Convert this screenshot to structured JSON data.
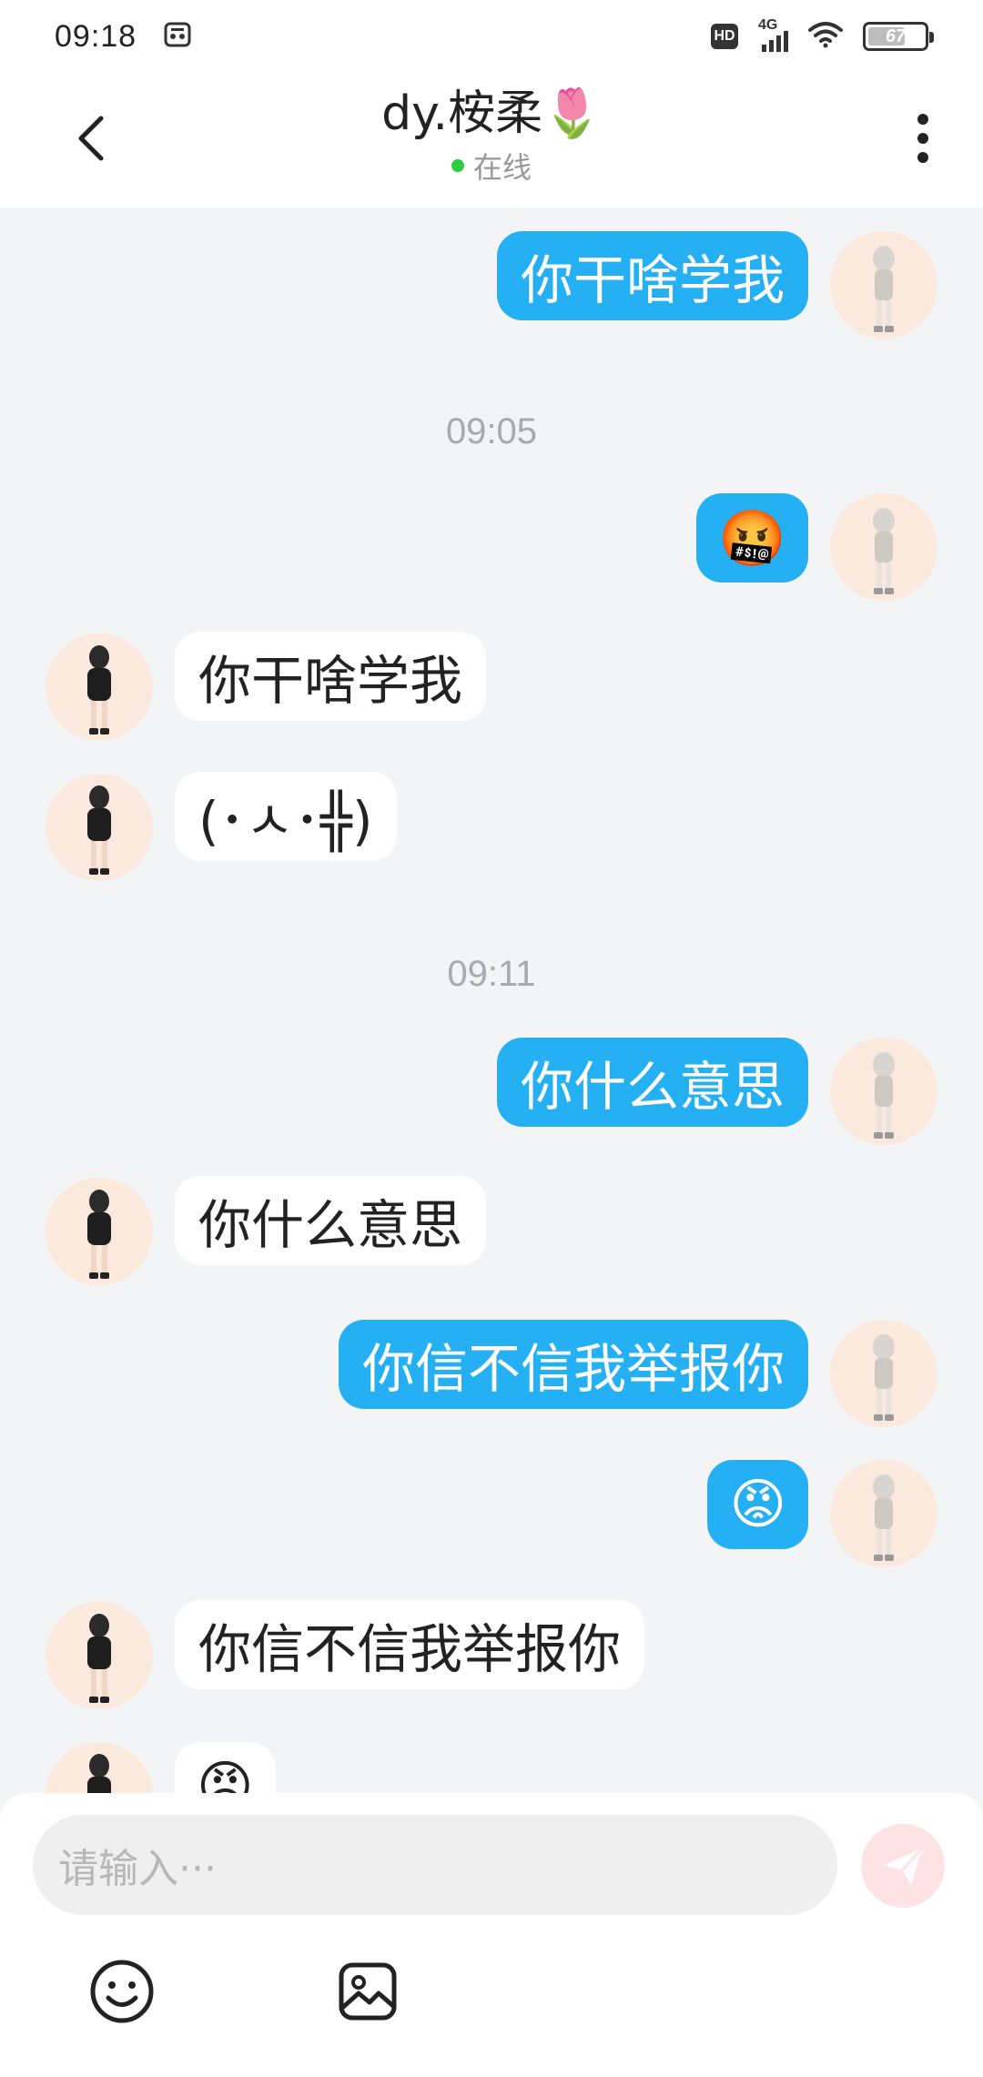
{
  "status_bar": {
    "time": "09:18",
    "network": "4G",
    "battery_text": "67",
    "battery_level_percent": 67
  },
  "header": {
    "contact_name": "dy.桉柔🌷",
    "status": "在线"
  },
  "messages": [
    {
      "side": "out",
      "text": "你干啥学我"
    },
    {
      "side": "time",
      "text": "09:05"
    },
    {
      "side": "out",
      "text": "🤬"
    },
    {
      "side": "in",
      "text": "你干啥学我"
    },
    {
      "side": "in",
      "text": "(･ㅅ･╬)"
    },
    {
      "side": "time",
      "text": "09:11"
    },
    {
      "side": "out",
      "text": "你什么意思"
    },
    {
      "side": "in",
      "text": "你什么意思"
    },
    {
      "side": "out",
      "text": "你信不信我举报你"
    },
    {
      "side": "out",
      "text": "😡"
    },
    {
      "side": "in",
      "text": "你信不信我举报你"
    },
    {
      "side": "in",
      "text": "😡"
    }
  ],
  "input": {
    "placeholder": "请输入···"
  },
  "icons": {
    "back": "chevron-left-icon",
    "more": "more-vertical-icon",
    "send": "send-icon",
    "emoji": "emoji-smile-icon",
    "image": "image-icon"
  },
  "colors": {
    "outgoing_bubble": "#25b0f4",
    "incoming_bubble": "#ffffff",
    "online_dot": "#2ecc40",
    "send_button": "#fde3e3"
  }
}
